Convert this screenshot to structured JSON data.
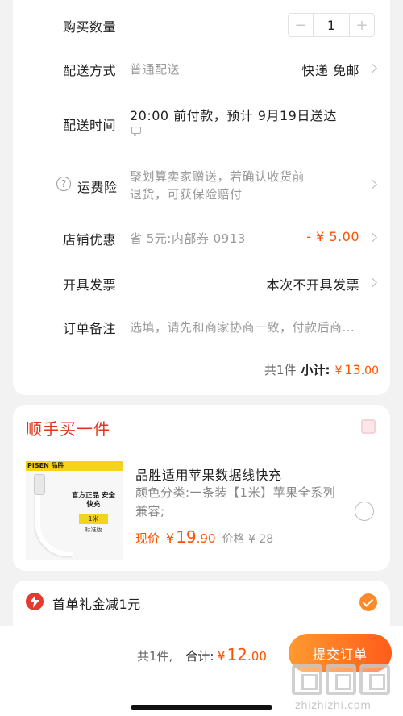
{
  "order": {
    "quantity": {
      "label": "购买数量",
      "minus": "−",
      "value": "1",
      "plus": "+"
    },
    "delivery_method": {
      "label": "配送方式",
      "value": "普通配送",
      "right": "快递 免邮"
    },
    "delivery_time": {
      "label": "配送时间",
      "value": "20:00 前付款，预计 9月19日送达"
    },
    "freight_insurance": {
      "label": "运费险",
      "icon_text": "?",
      "value_line1": "聚划算卖家赠送，若确认收货前",
      "value_line2": "退货，可获保险赔付"
    },
    "store_discount": {
      "label": "店铺优惠",
      "value": "省 5元:内部券 0913",
      "amount": "- ¥ 5.00"
    },
    "invoice": {
      "label": "开具发票",
      "value": "本次不开具发票"
    },
    "remark": {
      "label": "订单备注",
      "placeholder": "选填，请先和商家协商一致，付款后商..."
    },
    "summary": {
      "count": "共1件",
      "subtotal_label": "小计:",
      "currency": "¥",
      "integer": "13",
      "decimal": ".00"
    }
  },
  "addon": {
    "title": "顺手买一件",
    "product": {
      "title": "品胜适用苹果数据线快充",
      "sku": "颜色分类:一条装【1米】苹果全系列兼容;",
      "price_label": "现价",
      "currency": "¥",
      "price_int": "19",
      "price_dec": ".90",
      "original": "价格 ¥ 28",
      "thumb_brand": "PISEN 品胜",
      "thumb_text": "官方正品 安全快充",
      "thumb_tag": "1米",
      "thumb_tag2": "标准版"
    }
  },
  "coupon": {
    "text": "首单礼金减1元"
  },
  "bottom": {
    "count": "共1件,",
    "total_label": "合计:",
    "currency": "¥",
    "total_int": "12",
    "total_dec": ".00",
    "submit": "提交订单",
    "watermark": "zhizhizhi.com"
  },
  "colors": {
    "accent": "#ff5000",
    "title_red": "#e3331f",
    "check_orange": "#ff8a2a"
  }
}
